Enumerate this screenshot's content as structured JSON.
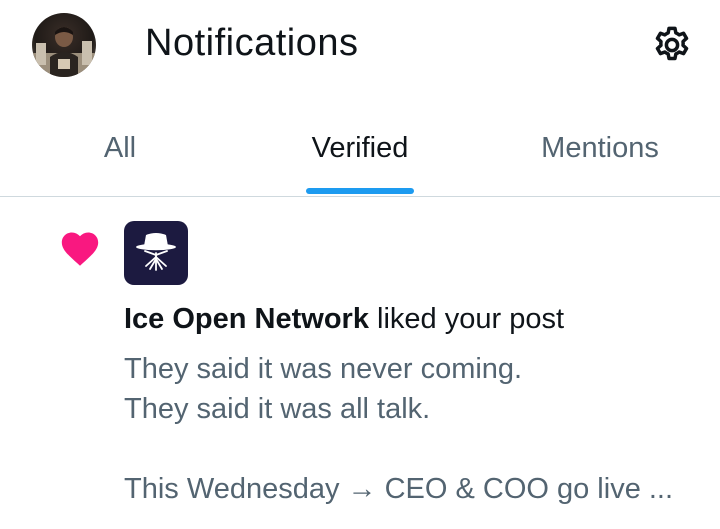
{
  "header": {
    "title": "Notifications",
    "avatar_icon": "user-avatar-photo",
    "settings_icon": "gear-icon"
  },
  "tabs": [
    {
      "label": "All",
      "active": false
    },
    {
      "label": "Verified",
      "active": true
    },
    {
      "label": "Mentions",
      "active": false
    }
  ],
  "colors": {
    "accent": "#1d9bf0",
    "like": "#f91880",
    "text_primary": "#0f1419",
    "text_secondary": "#536471",
    "brand_bg": "#1c1a40"
  },
  "notification": {
    "type_icon": "heart-icon",
    "account_icon": "ice-open-network-logo",
    "actor": "Ice Open Network",
    "action": " liked your post",
    "post_lines": [
      "They said it was never coming.",
      "They said it was all talk.",
      "",
      "This Wednesday → CEO & COO go live ..."
    ]
  }
}
